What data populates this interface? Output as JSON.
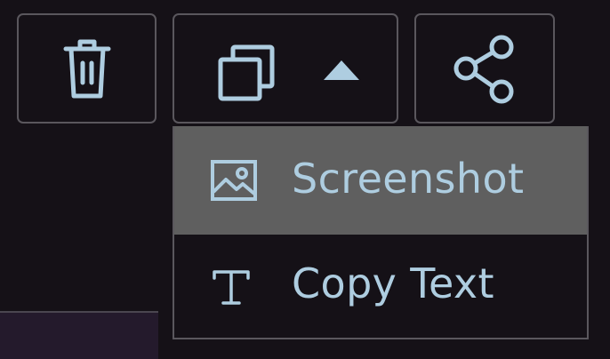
{
  "toolbar": {
    "buttons": [
      {
        "name": "delete",
        "icon": "trash-icon"
      },
      {
        "name": "copy",
        "icon": "copy-icon",
        "secondary_icon": "caret-up-icon"
      },
      {
        "name": "share",
        "icon": "share-icon"
      }
    ]
  },
  "dropdown": {
    "items": [
      {
        "label": "Screenshot",
        "icon": "image-icon",
        "selected": true
      },
      {
        "label": "Copy Text",
        "icon": "text-icon",
        "selected": false
      }
    ]
  },
  "colors": {
    "background": "#151117",
    "border": "#5a575d",
    "icon": "#aecde0",
    "selected_item": "#5f5f5f",
    "panel_strip": "#241a2c"
  }
}
